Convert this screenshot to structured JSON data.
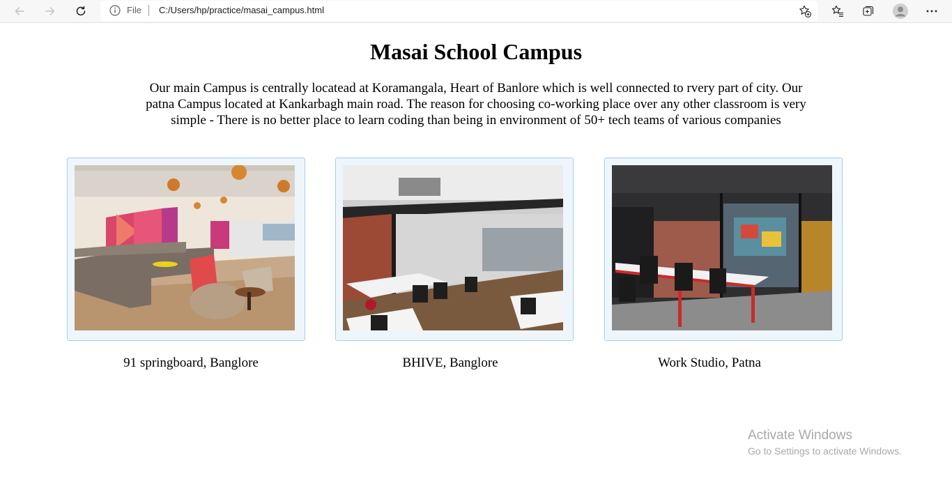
{
  "browser": {
    "scheme_label": "File",
    "url": "C:/Users/hp/practice/masai_campus.html",
    "icons": {
      "back": "arrow-left-icon",
      "forward": "arrow-right-icon",
      "refresh": "refresh-icon",
      "site_info": "info-icon",
      "add_favorite": "star-add-icon",
      "favorites": "favorites-list-icon",
      "collections": "collections-icon",
      "profile": "avatar-icon",
      "menu": "more-icon"
    }
  },
  "page": {
    "title": "Masai School Campus",
    "intro": "Our main Campus is centrally locatead at Koramangala, Heart of Banlore which is well connected to rvery part of city. Our patna Campus located at Kankarbagh main road. The reason for choosing co-working place over any other classroom is very simple - There is no better place to learn coding than being in environment of 50+ tech teams of various companies",
    "campuses": [
      {
        "caption": "91 springboard, Banglore"
      },
      {
        "caption": "BHIVE, Banglore"
      },
      {
        "caption": "Work Studio, Patna"
      }
    ]
  },
  "overlay": {
    "watermark_title": "Activate Windows",
    "watermark_sub": "Go to Settings to activate Windows."
  },
  "colors": {
    "card_bg": "#eef6fc",
    "card_border": "#9fd0ef",
    "watermark": "#a9a9a9"
  }
}
